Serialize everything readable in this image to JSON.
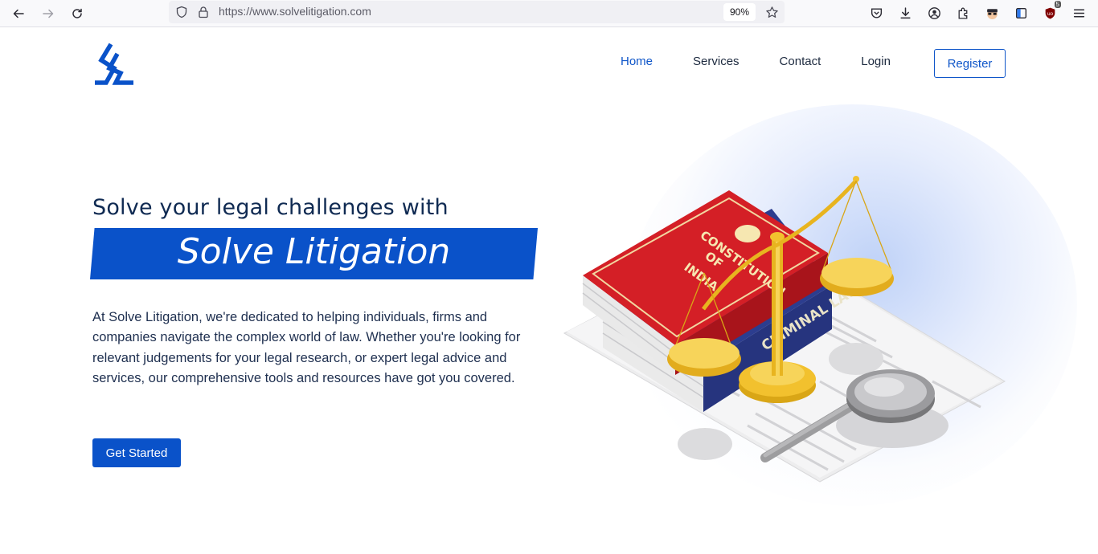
{
  "browser": {
    "url": "https://www.solvelitigation.com",
    "zoom": "90%",
    "extension_badge": "5"
  },
  "nav": {
    "items": [
      {
        "label": "Home",
        "active": true
      },
      {
        "label": "Services",
        "active": false
      },
      {
        "label": "Contact",
        "active": false
      },
      {
        "label": "Login",
        "active": false
      }
    ],
    "register_label": "Register"
  },
  "hero": {
    "headline": "Solve your legal challenges with",
    "banner": "Solve Litigation",
    "description": "At Solve Litigation, we're dedicated to helping individuals, firms and companies navigate the complex world of law. Whether you're looking for relevant judgements for your legal research, or expert legal advice and services, our comprehensive tools and resources have got you covered.",
    "cta_label": "Get Started"
  },
  "illustration": {
    "book_top": "CONSTITUTION OF INDIA",
    "book_bottom": "CRIMINAL LAW",
    "lettering_lines": [
      "CONSTITUTION",
      "OF",
      "INDIA"
    ]
  },
  "colors": {
    "brand_blue": "#0a52c9",
    "heading_navy": "#0f2a52",
    "book_red": "#d41f26",
    "book_blue": "#2c3d8f",
    "scale_gold": "#f2c12e"
  }
}
